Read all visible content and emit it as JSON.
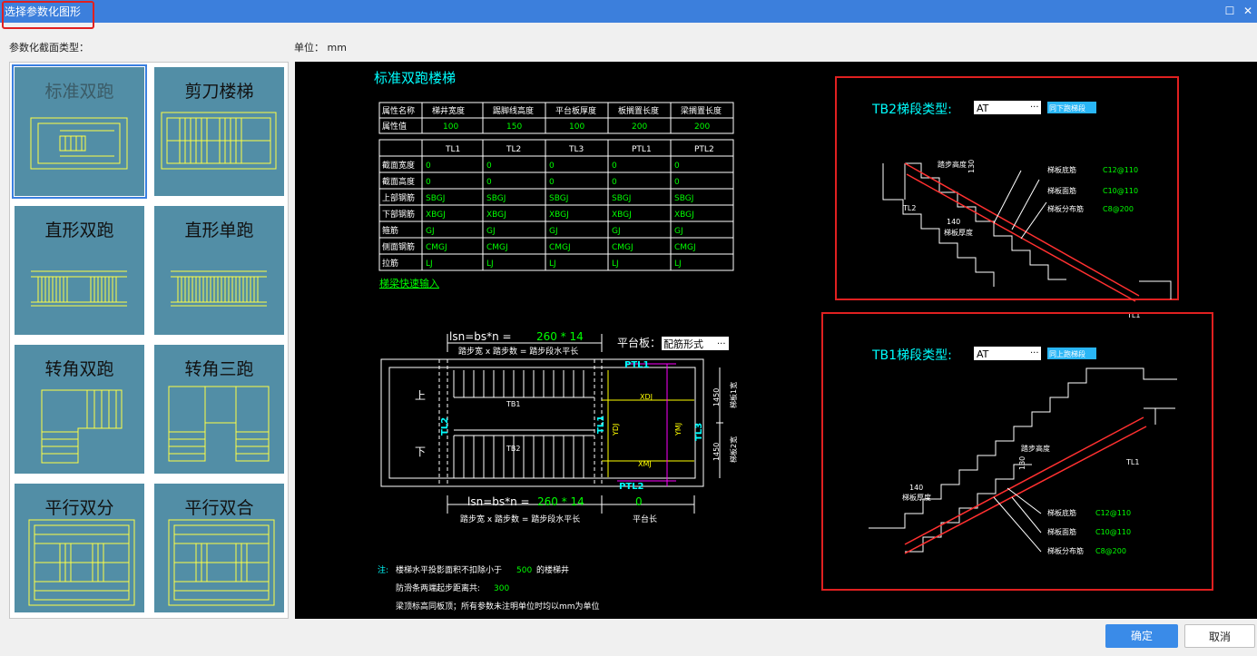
{
  "window": {
    "title": "选择参数化图形"
  },
  "section_label": "参数化截面类型：",
  "unit": {
    "label": "单位：",
    "value": "mm"
  },
  "thumbnails": [
    "标准双跑",
    "剪刀楼梯",
    "直形双跑",
    "直形单跑",
    "转角双跑",
    "转角三跑",
    "平行双分",
    "平行双合"
  ],
  "preview": {
    "title": "标准双跑楼梯",
    "table1": {
      "headers": [
        "属性名称",
        "梯井宽度",
        "踢脚线高度",
        "平台板厚度",
        "板搁置长度",
        "梁搁置长度"
      ],
      "row_label": "属性值",
      "values": [
        "100",
        "150",
        "100",
        "200",
        "200"
      ]
    },
    "table2": {
      "columns": [
        "TL1",
        "TL2",
        "TL3",
        "PTL1",
        "PTL2"
      ],
      "rows": [
        {
          "label": "截面宽度",
          "values": [
            "0",
            "0",
            "0",
            "0",
            "0"
          ]
        },
        {
          "label": "截面高度",
          "values": [
            "0",
            "0",
            "0",
            "0",
            "0"
          ]
        },
        {
          "label": "上部钢筋",
          "values": [
            "SBGJ",
            "SBGJ",
            "SBGJ",
            "SBGJ",
            "SBGJ"
          ]
        },
        {
          "label": "下部钢筋",
          "values": [
            "XBGJ",
            "XBGJ",
            "XBGJ",
            "XBGJ",
            "XBGJ"
          ]
        },
        {
          "label": "箍筋",
          "values": [
            "GJ",
            "GJ",
            "GJ",
            "GJ",
            "GJ"
          ]
        },
        {
          "label": "侧面钢筋",
          "values": [
            "CMGJ",
            "CMGJ",
            "CMGJ",
            "CMGJ",
            "CMGJ"
          ]
        },
        {
          "label": "拉筋",
          "values": [
            "LJ",
            "LJ",
            "LJ",
            "LJ",
            "LJ"
          ]
        }
      ]
    },
    "quick_link": "梯梁快速输入",
    "plan": {
      "top_formula": "lsn=bs*n =",
      "top_value": "260 * 14",
      "top_caption": "踏步宽 x 踏步数 = 踏步段水平长",
      "platform_label": "平台板：",
      "platform_value": "配筋形式",
      "bottom_formula": "lsn=bs*n =",
      "bottom_value": "260 * 14",
      "bottom_caption": "踏步宽 x 踏步数 = 踏步段水平长",
      "platform_len_value": "0",
      "platform_len_caption": "平台长",
      "up": "上",
      "down": "下",
      "tb1": "TB1",
      "tb2": "TB2",
      "tl1": "TL1",
      "tl2": "TL2",
      "tl3": "TL3",
      "ptl1": "PTL1",
      "ptl2": "PTL2",
      "xdj": "XDJ",
      "xmj": "XMJ",
      "ydj": "YDJ",
      "ymj": "YMJ",
      "dim1": "1450",
      "dim2": "1450",
      "w1": "梯板1宽",
      "w2": "梯板2宽"
    },
    "notes": {
      "prefix": "注:",
      "line1a": "楼梯水平投影面积不扣除小于",
      "line1b": "500",
      "line1c": "的楼梯井",
      "line2a": "防滑条两端起步距离共:",
      "line2b": "300",
      "line3": "梁顶标高同板顶；所有参数未注明单位时均以mm为单位"
    },
    "tb2": {
      "label": "TB2梯段类型:",
      "type": "AT",
      "button": "同下跑梯段",
      "step_height": "踏步高度",
      "sh_val": "130",
      "thickness_val": "140",
      "thickness_label": "梯板厚度",
      "bottom_bar": "梯板底筋",
      "bottom_bar_val": "C12@110",
      "top_bar": "梯板面筋",
      "top_bar_val": "C10@110",
      "dist_bar": "梯板分布筋",
      "dist_bar_val": "C8@200",
      "tl2": "TL2",
      "tl1": "TL1"
    },
    "tb1": {
      "label": "TB1梯段类型:",
      "type": "AT",
      "button": "同上跑梯段",
      "step_height": "踏步高度",
      "sh_val": "130",
      "thickness_val": "140",
      "thickness_label": "梯板厚度",
      "bottom_bar": "梯板底筋",
      "bottom_bar_val": "C12@110",
      "top_bar": "梯板面筋",
      "top_bar_val": "C10@110",
      "dist_bar": "梯板分布筋",
      "dist_bar_val": "C8@200",
      "tl1": "TL1"
    }
  },
  "buttons": {
    "ok": "确定",
    "cancel": "取消"
  },
  "colors": {
    "titlebar": "#3c7fdc",
    "highlight": "#e02020",
    "thumb_bg": "#528ea6",
    "cad_yellow": "#ffff00",
    "cad_cyan": "#00ffff",
    "cad_green": "#00ff00",
    "cad_red": "#ff0000",
    "cad_magenta": "#ff00ff"
  },
  "icons": {
    "maximize": "maximize-icon",
    "close": "close-icon"
  }
}
